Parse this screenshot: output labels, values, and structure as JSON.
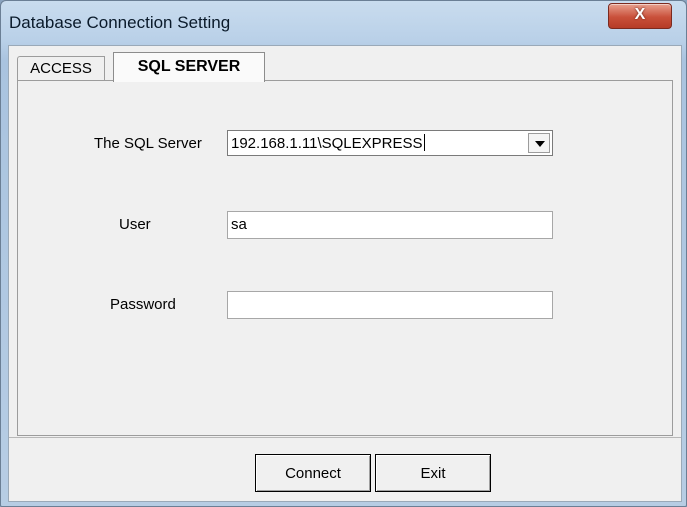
{
  "window": {
    "title": "Database Connection Setting",
    "close_glyph": "X"
  },
  "tabs": [
    {
      "label": "ACCESS",
      "selected": false
    },
    {
      "label": "SQL SERVER",
      "selected": true
    }
  ],
  "form": {
    "server_label": "The SQL Server",
    "server_value": "192.168.1.11\\SQLEXPRESS",
    "user_label": "User",
    "user_value": "sa",
    "password_label": "Password",
    "password_value": ""
  },
  "buttons": {
    "connect_label": "Connect",
    "exit_label": "Exit"
  },
  "icons": {
    "close": "close-icon",
    "dropdown": "chevron-down-icon"
  },
  "colors": {
    "close_button": "#c9503a",
    "title_bar": "#b9d0e8",
    "dialog_bg": "#f0f0f0"
  }
}
